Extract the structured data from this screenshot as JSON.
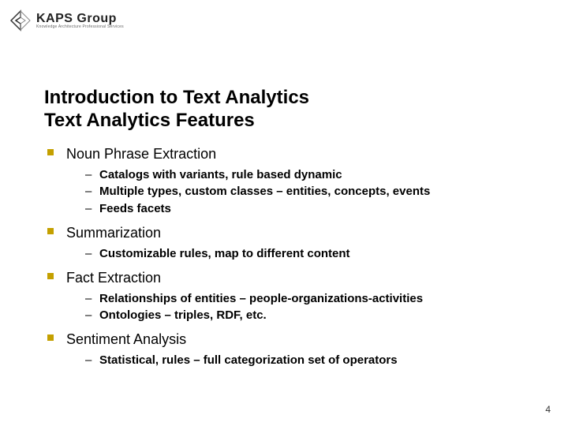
{
  "logo": {
    "name": "KAPS Group",
    "tagline": "Knowledge Architecture Professional Services"
  },
  "title_line1": "Introduction to Text Analytics",
  "title_line2": "Text Analytics Features",
  "bullets": [
    {
      "label": "Noun Phrase Extraction",
      "sub": [
        "Catalogs with variants, rule based dynamic",
        "Multiple types, custom classes – entities, concepts, events",
        "Feeds facets"
      ]
    },
    {
      "label": "Summarization",
      "sub": [
        "Customizable rules, map to different content"
      ]
    },
    {
      "label": "Fact Extraction",
      "sub": [
        "Relationships of entities – people-organizations-activities",
        "Ontologies – triples, RDF, etc."
      ]
    },
    {
      "label": "Sentiment Analysis",
      "sub": [
        "Statistical, rules – full categorization set of operators"
      ]
    }
  ],
  "page_number": "4"
}
